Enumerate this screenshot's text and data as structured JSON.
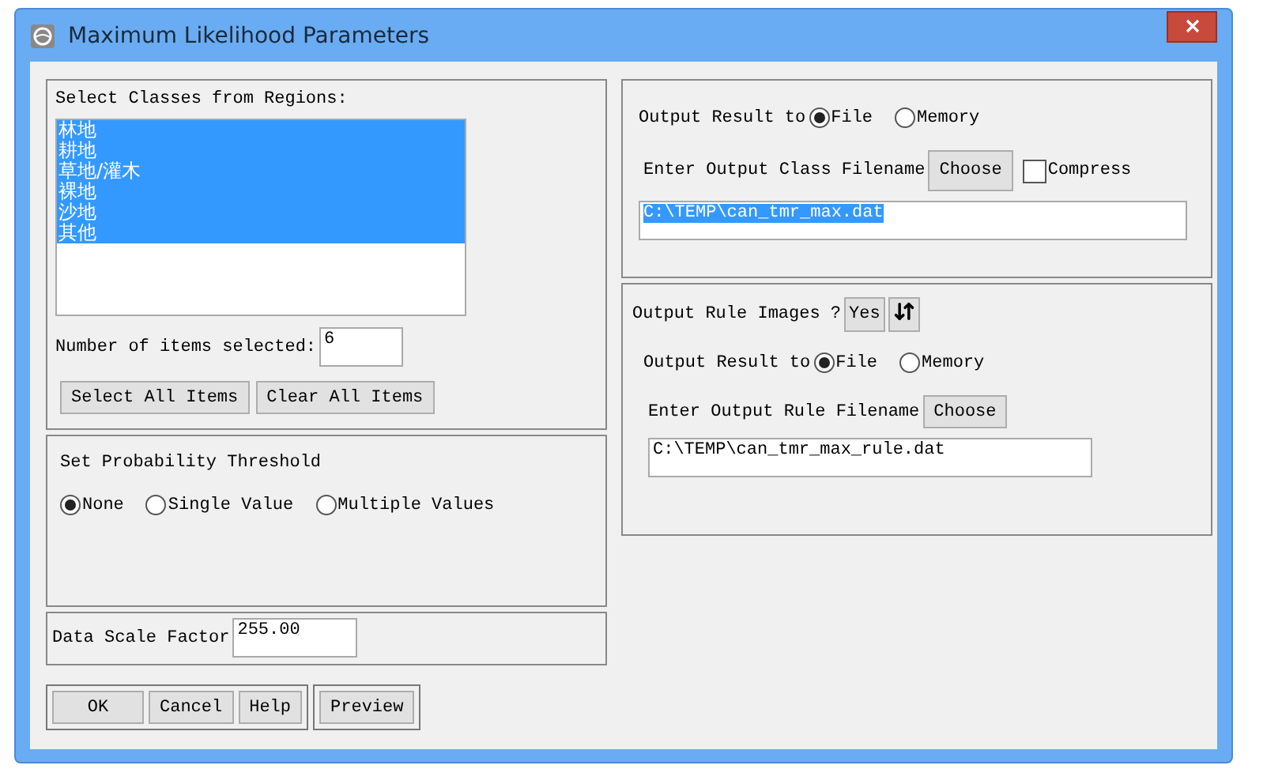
{
  "window": {
    "title": "Maximum Likelihood Parameters"
  },
  "classes": {
    "label": "Select Classes from Regions:",
    "items": [
      {
        "label": "林地",
        "selected": true
      },
      {
        "label": "耕地",
        "selected": true
      },
      {
        "label": "草地/灌木",
        "selected": true
      },
      {
        "label": "裸地",
        "selected": true
      },
      {
        "label": "沙地",
        "selected": true
      },
      {
        "label": "其他",
        "selected": true
      }
    ],
    "count_label": "Number of items selected:",
    "count_value": "6",
    "buttons": [
      "Select All Items",
      "Clear All Items"
    ]
  },
  "threshold": {
    "label": "Set Probability Threshold",
    "options": [
      {
        "label": "None",
        "selected": true
      },
      {
        "label": "Single Value",
        "selected": false
      },
      {
        "label": "Multiple Values",
        "selected": false
      }
    ]
  },
  "scale": {
    "label": "Data Scale Factor",
    "value": "255.00"
  },
  "buttons": [
    "OK",
    "Cancel",
    "Help"
  ],
  "preview": "Preview",
  "output": {
    "label": "Output Result to",
    "options": [
      {
        "label": "File",
        "selected": true
      },
      {
        "label": "Memory",
        "selected": false
      }
    ],
    "filename_label": "Enter Output Class Filename",
    "choose": "Choose",
    "compress": {
      "label": "Compress",
      "checked": false
    },
    "filename": "C:\\TEMP\\can_tmr_max.dat",
    "filename_highlighted": true
  },
  "rules": {
    "label": "Output Rule Images ?",
    "toggle": "Yes",
    "output_label": "Output Result to",
    "options": [
      {
        "label": "File",
        "selected": true
      },
      {
        "label": "Memory",
        "selected": false
      }
    ],
    "filename_label": "Enter Output Rule Filename",
    "choose": "Choose",
    "filename": "C:\\TEMP\\can_tmr_max_rule.dat",
    "filename_highlighted": false
  }
}
